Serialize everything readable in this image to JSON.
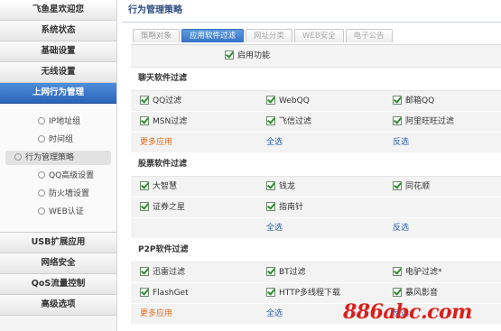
{
  "sidebar": {
    "welcome": "飞鱼星欢迎您",
    "items_top": [
      "系统状态",
      "基础设置",
      "无线设置"
    ],
    "active_item": "上网行为管理",
    "sub_items": [
      "IP地址组",
      "时间组",
      "行为管理策略",
      "QQ高级设置",
      "防火墙设置",
      "WEB认证"
    ],
    "items_bottom": [
      "USB扩展应用",
      "网络安全",
      "QoS流量控制",
      "高级选项"
    ]
  },
  "page": {
    "title": "行为管理策略"
  },
  "tabs": [
    {
      "label": "策略对象",
      "active": false
    },
    {
      "label": "应用软件过滤",
      "active": true
    },
    {
      "label": "网址分类",
      "active": false
    },
    {
      "label": "WEB安全",
      "active": false
    },
    {
      "label": "电子公告",
      "active": false
    }
  ],
  "enable": {
    "label": "启用功能",
    "checked": true
  },
  "sections": {
    "chat": {
      "title": "聊天软件过滤",
      "row1": [
        "QQ过滤",
        "WebQQ",
        "邮箱QQ"
      ],
      "row2": [
        "MSN过滤",
        "飞信过滤",
        "阿里旺旺过滤"
      ],
      "more": "更多应用",
      "select_all": "全选",
      "invert": "反选"
    },
    "stock": {
      "title": "股票软件过滤",
      "row1": [
        "大智慧",
        "钱龙",
        "同花顺"
      ],
      "row2": [
        "证券之星",
        "指南针"
      ],
      "select_all": "全选",
      "invert": "反选"
    },
    "p2p": {
      "title": "P2P软件过滤",
      "row1": [
        "迅雷过滤",
        "BT过滤",
        "电驴过滤*"
      ],
      "row2": [
        "FlashGet",
        "HTTP多线程下载",
        "暴风影音"
      ],
      "more": "更多应用",
      "select_all": "全选",
      "invert": "反选"
    }
  },
  "watermark": "886abc.com",
  "colors": {
    "accent": "#2c64b8",
    "link_orange": "#e06a1a",
    "link_blue": "#2c62b0",
    "watermark": "#d9201b"
  }
}
